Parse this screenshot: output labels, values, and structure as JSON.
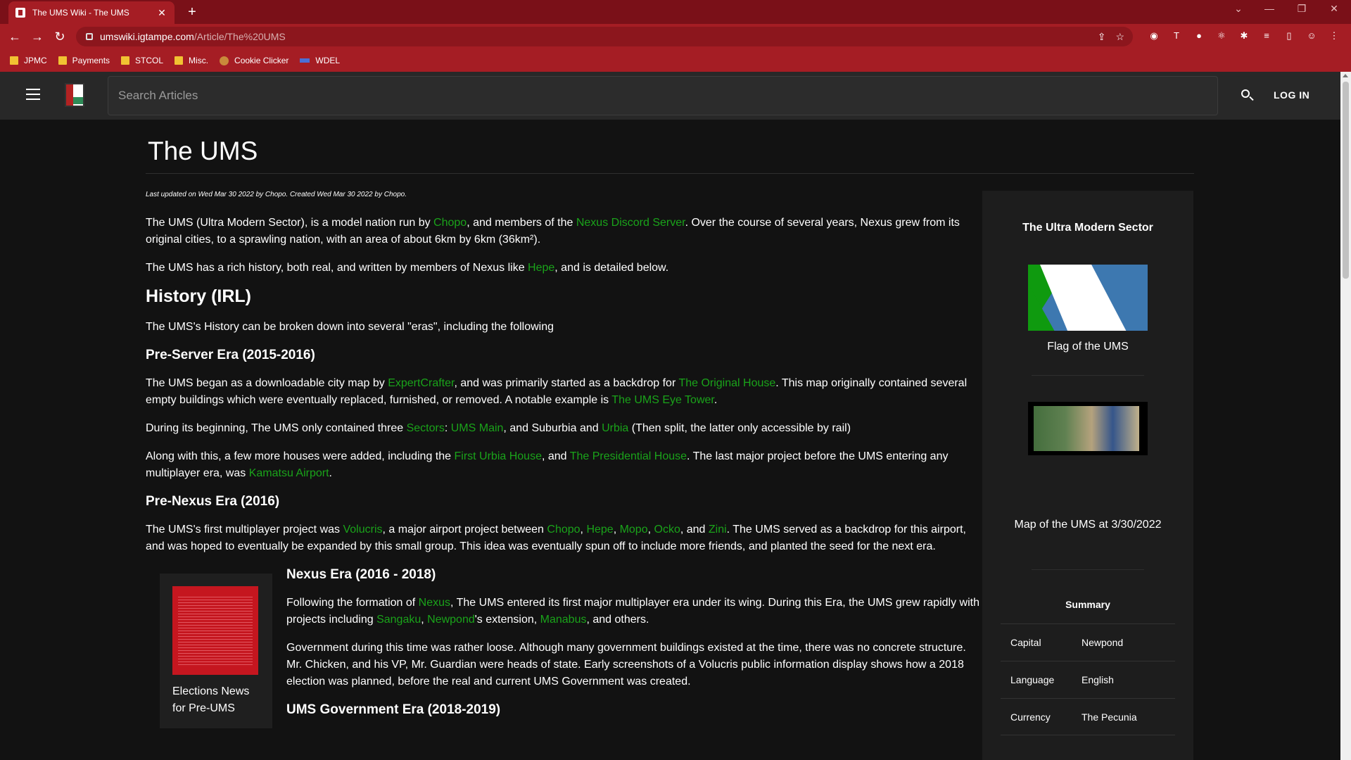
{
  "browser": {
    "tab_title": "The UMS Wiki - The UMS",
    "url_host": "umswiki.igtampe.com",
    "url_path": "/Article/The%20UMS",
    "bookmarks": [
      "JPMC",
      "Payments",
      "STCOL",
      "Misc.",
      "Cookie Clicker",
      "WDEL"
    ]
  },
  "header": {
    "search_placeholder": "Search Articles",
    "login_label": "LOG IN"
  },
  "article": {
    "title": "The UMS",
    "meta": "Last updated on Wed Mar 30 2022 by Chopo. Created Wed Mar 30 2022 by Chopo.",
    "p1": {
      "t1": "The UMS (Ultra Modern Sector), is a model nation run by ",
      "l1": "Chopo",
      "t2": ", and members of the ",
      "l2": "Nexus Discord Server",
      "t3": ". Over the course of several years, Nexus grew from its original cities, to a sprawling nation, with an area of about 6km by 6km (36km²)."
    },
    "p2": {
      "t1": "The UMS has a rich history, both real, and written by members of Nexus like ",
      "l1": "Hepe",
      "t2": ", and is detailed below."
    },
    "h_history": "History (IRL)",
    "p3": "The UMS's History can be broken down into several \"eras\", including the following",
    "h_preserver": "Pre-Server Era (2015-2016)",
    "p4": {
      "t1": "The UMS began as a downloadable city map by ",
      "l1": "ExpertCrafter",
      "t2": ", and was primarily started as a backdrop for ",
      "l2": "The Original House",
      "t3": ". This map originally contained several empty buildings which were eventually replaced, furnished, or removed. A notable example is ",
      "l3": "The UMS Eye Tower",
      "t4": "."
    },
    "p5": {
      "t1": "During its beginning, The UMS only contained three ",
      "l1": "Sectors",
      "t2": ": ",
      "l2": "UMS Main",
      "t3": ", and Suburbia and ",
      "l3": "Urbia",
      "t4": " (Then split, the latter only accessible by rail)"
    },
    "p6": {
      "t1": "Along with this, a few more houses were added, including the ",
      "l1": "First Urbia House",
      "t2": ", and ",
      "l2": "The Presidential House",
      "t3": ". The last major project before the UMS entering any multiplayer era, was ",
      "l3": "Kamatsu Airport",
      "t4": "."
    },
    "h_prenexus": "Pre-Nexus Era (2016)",
    "p7": {
      "t1": "The UMS's first multiplayer project was ",
      "l1": "Volucris",
      "t2": ", a major airport project between ",
      "l2": "Chopo",
      "t3": ", ",
      "l3": "Hepe",
      "t4": ", ",
      "l4": "Mopo",
      "t5": ", ",
      "l5": "Ocko",
      "t6": ", and ",
      "l6": "Zini",
      "t7": ". The UMS served as a backdrop for this airport, and was hoped to eventually be expanded by this small group. This idea was eventually spun off to include more friends, and planted the seed for the next era."
    },
    "thumb_caption": "Elections News for Pre-UMS",
    "h_nexus": "Nexus Era (2016 - 2018)",
    "p8": {
      "t1": "Following the formation of ",
      "l1": "Nexus",
      "t2": ", The UMS entered its first major multiplayer era under its wing. During this Era, the UMS grew rapidly with projects including ",
      "l2": "Sangaku",
      "t3": ", ",
      "l3": "Newpond",
      "t4": "'s extension, ",
      "l4": "Manabus",
      "t5": ", and others."
    },
    "p9": "Government during this time was rather loose. Although many government buildings existed at the time, there was no concrete structure. Mr. Chicken, and his VP, Mr. Guardian were heads of state. Early screenshots of a Volucris public information display shows how a 2018 election was planned, before the real and current UMS Government was created.",
    "h_gov": "UMS Government Era (2018-2019)"
  },
  "infobox": {
    "title": "The Ultra Modern Sector",
    "flag_caption": "Flag of the UMS",
    "map_caption": "Map of the UMS at 3/30/2022",
    "summary_title": "Summary",
    "rows": [
      {
        "key": "Capital",
        "value": "Newpond"
      },
      {
        "key": "Language",
        "value": "English"
      },
      {
        "key": "Currency",
        "value": "The Pecunia"
      }
    ]
  },
  "colors": {
    "link": "#1aa31a",
    "chrome": "#a51d24",
    "appbar": "#282828",
    "background": "#121212"
  }
}
